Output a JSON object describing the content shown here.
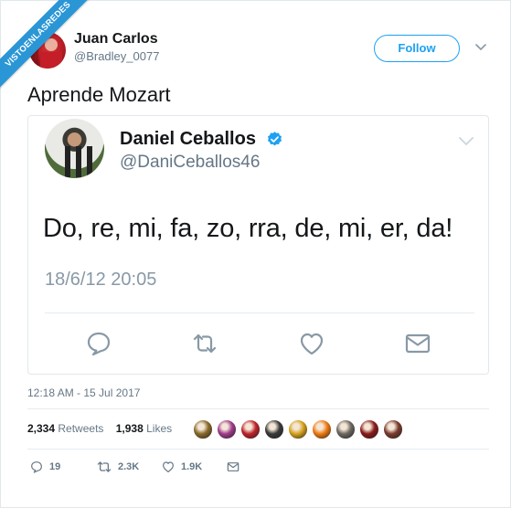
{
  "watermark": {
    "text": "VISTOENLASREDES",
    "color": "#2a96d6"
  },
  "tweet": {
    "user_name": "Juan Carlos",
    "user_handle": "@Bradley_0077",
    "follow_label": "Follow",
    "text": "Aprende Mozart",
    "timestamp": "12:18 AM - 15 Jul 2017",
    "retweets_count": "2,334",
    "retweets_label": "Retweets",
    "likes_count": "1,938",
    "likes_label": "Likes",
    "actions": {
      "reply": "19",
      "retweet": "2.3K",
      "like": "1.9K"
    }
  },
  "quoted": {
    "name": "Daniel Ceballos",
    "handle": "@DaniCeballos46",
    "text": "Do, re, mi, fa, zo, rra, de, mi, er, da!",
    "date": "18/6/12 20:05"
  },
  "icons": [
    "verified-badge-icon",
    "chevron-down-icon",
    "reply-icon",
    "retweet-icon",
    "like-icon",
    "message-icon"
  ],
  "colors": {
    "accent": "#1da1f2",
    "muted": "#657786",
    "text": "#14171a"
  },
  "liker_avatars": [
    {
      "color": "#8a6a2a"
    },
    {
      "color": "#a03c8c"
    },
    {
      "color": "#c0232b"
    },
    {
      "color": "#3a3a3a"
    },
    {
      "color": "#d7a21c"
    },
    {
      "color": "#f07a12"
    },
    {
      "color": "#6d6860"
    },
    {
      "color": "#8b1a1a"
    },
    {
      "color": "#7a3b2e"
    }
  ]
}
